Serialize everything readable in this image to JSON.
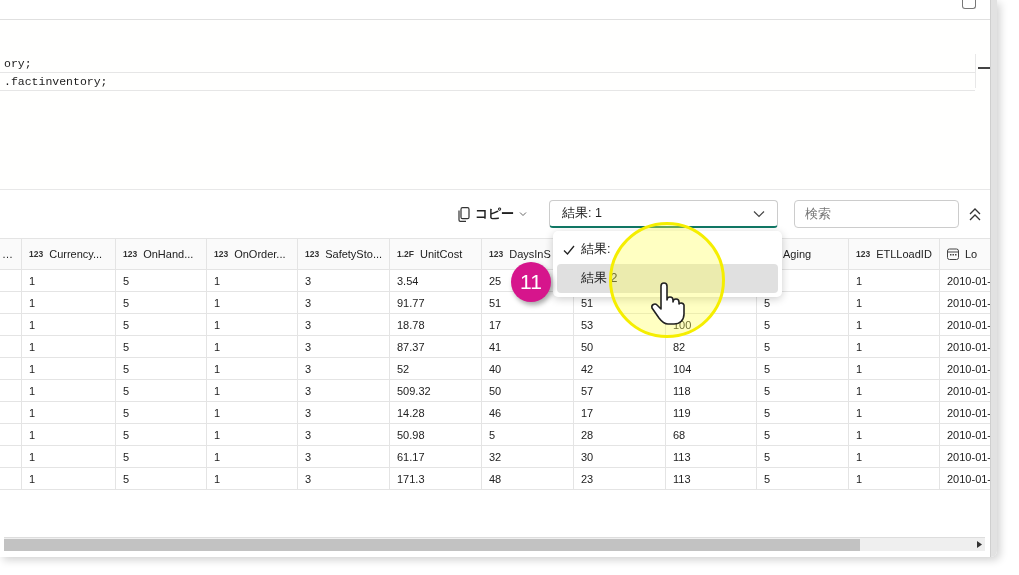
{
  "editor": {
    "lines": [
      {
        "text": "ory;",
        "current": false
      },
      {
        "text": ".factinventory;",
        "current": true
      }
    ]
  },
  "toolbar": {
    "copy_label": "コピー",
    "result_select": {
      "value": "結果: 1",
      "focused": true
    },
    "search": {
      "placeholder": "検索"
    }
  },
  "result_menu": [
    {
      "label": "結果:",
      "selected": true,
      "hovered": false
    },
    {
      "label": "結果 2",
      "selected": false,
      "hovered": true
    }
  ],
  "step_badge": "11",
  "table": {
    "columns": [
      {
        "kind": "plain",
        "label": "…"
      },
      {
        "kind": "number",
        "type_label": "123",
        "label": "Currency..."
      },
      {
        "kind": "number",
        "type_label": "123",
        "label": "OnHand..."
      },
      {
        "kind": "number",
        "type_label": "123",
        "label": "OnOrder..."
      },
      {
        "kind": "number",
        "type_label": "123",
        "label": "SafetySto..."
      },
      {
        "kind": "number",
        "type_label": "1.2F",
        "label": "UnitCost"
      },
      {
        "kind": "number",
        "type_label": "123",
        "label": "DaysInS"
      },
      {
        "kind": "blank"
      },
      {
        "kind": "blank"
      },
      {
        "kind": "plain",
        "label": "Aging"
      },
      {
        "kind": "number",
        "type_label": "123",
        "label": "ETLLoadID"
      },
      {
        "kind": "date",
        "label": "Lo"
      }
    ],
    "rows": [
      [
        null,
        "1",
        "5",
        "1",
        "3",
        "3.54",
        "25",
        null,
        null,
        null,
        "1",
        "2010-01-"
      ],
      [
        null,
        "1",
        "5",
        "1",
        "3",
        "91.77",
        "51",
        "51",
        null,
        "5",
        "1",
        "2010-01-"
      ],
      [
        null,
        "1",
        "5",
        "1",
        "3",
        "18.78",
        "17",
        "53",
        "100",
        "5",
        "1",
        "2010-01-"
      ],
      [
        null,
        "1",
        "5",
        "1",
        "3",
        "87.37",
        "41",
        "50",
        "82",
        "5",
        "1",
        "2010-01-"
      ],
      [
        null,
        "1",
        "5",
        "1",
        "3",
        "52",
        "40",
        "42",
        "104",
        "5",
        "1",
        "2010-01-"
      ],
      [
        null,
        "1",
        "5",
        "1",
        "3",
        "509.32",
        "50",
        "57",
        "118",
        "5",
        "1",
        "2010-01-"
      ],
      [
        null,
        "1",
        "5",
        "1",
        "3",
        "14.28",
        "46",
        "17",
        "119",
        "5",
        "1",
        "2010-01-"
      ],
      [
        null,
        "1",
        "5",
        "1",
        "3",
        "50.98",
        "5",
        "28",
        "68",
        "5",
        "1",
        "2010-01-"
      ],
      [
        null,
        "1",
        "5",
        "1",
        "3",
        "61.17",
        "32",
        "30",
        "113",
        "5",
        "1",
        "2010-01-"
      ],
      [
        null,
        "1",
        "5",
        "1",
        "3",
        "171.3",
        "48",
        "23",
        "113",
        "5",
        "1",
        "2010-01-"
      ]
    ]
  }
}
